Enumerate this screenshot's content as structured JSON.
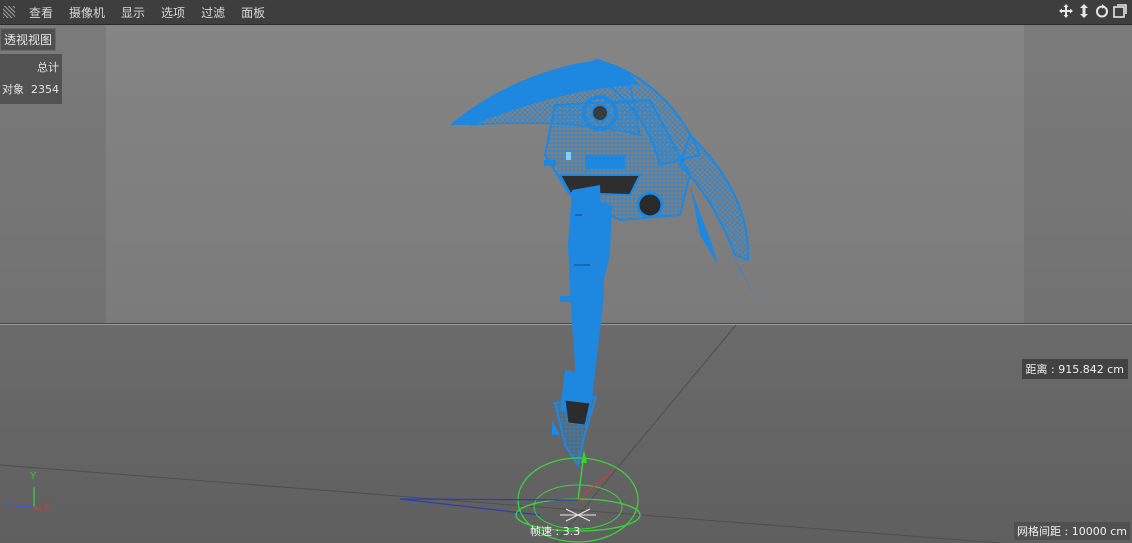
{
  "menubar": {
    "items": [
      "查看",
      "摄像机",
      "显示",
      "选项",
      "过滤",
      "面板"
    ]
  },
  "nav_icons": [
    "move-view-icon",
    "dolly-view-icon",
    "rotate-view-icon",
    "toggle-layout-icon"
  ],
  "viewport": {
    "view_name": "透视视图",
    "stats": {
      "header": "总计",
      "rows": [
        {
          "label": "对象",
          "value": "2354"
        }
      ]
    },
    "distance": "距离 : 915.842 cm",
    "grid_spacing": "网格间距 : 10000 cm",
    "fps": "帧速 : 3.3",
    "axis_labels": {
      "y": "Y",
      "z": "Z",
      "x": "X"
    }
  },
  "colors": {
    "mesh": "#1e88e0",
    "gizmo": "#3cd23c",
    "axis_y": "#39c439",
    "axis_z": "#3a5fcf",
    "axis_x": "#d23a3a"
  }
}
